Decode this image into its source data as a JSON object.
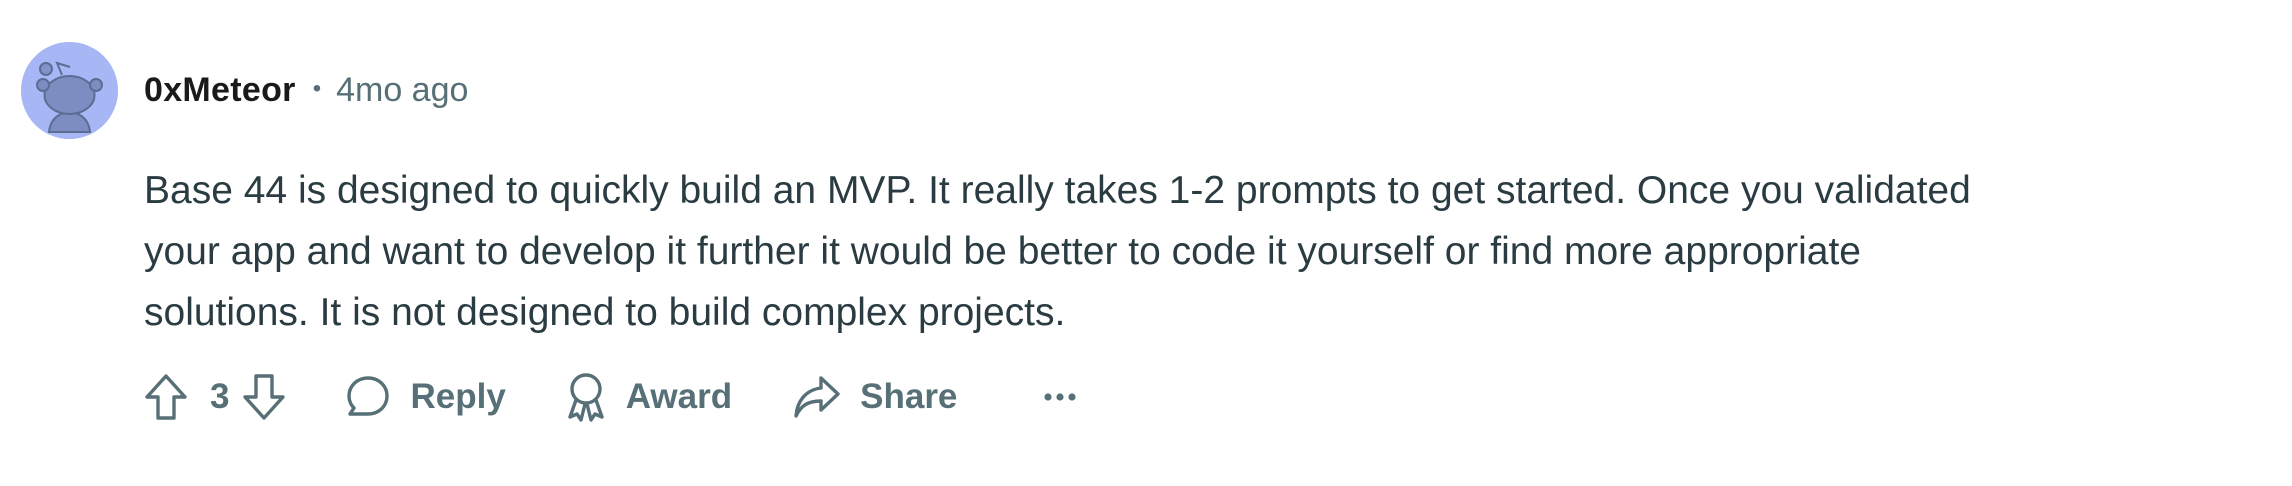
{
  "comment": {
    "author": "0xMeteor",
    "separator": "•",
    "time_ago": "4mo ago",
    "body_lines": [
      "Base 44 is designed to quickly build an MVP. It really takes 1-2 prompts to get started. Once you validated",
      "your app and want to develop it further it would be better to code it yourself or find more appropriate",
      "solutions. It is not designed to build complex projects."
    ]
  },
  "actions": {
    "upvote_icon": "arrow-up-outline-icon",
    "vote_count": "3",
    "downvote_icon": "arrow-down-outline-icon",
    "reply_icon": "speech-bubble-icon",
    "reply_label": "Reply",
    "award_icon": "award-ribbon-icon",
    "award_label": "Award",
    "share_icon": "share-arrow-icon",
    "share_label": "Share",
    "more_icon": "ellipsis-icon",
    "more_label": "···"
  },
  "colors": {
    "avatar_bg": "#a7b7f5",
    "avatar_figure": "#5a6d93",
    "text_primary": "#1a1a1b",
    "text_body": "#2a3c42",
    "text_secondary": "#576f76",
    "background": "#ffffff"
  }
}
